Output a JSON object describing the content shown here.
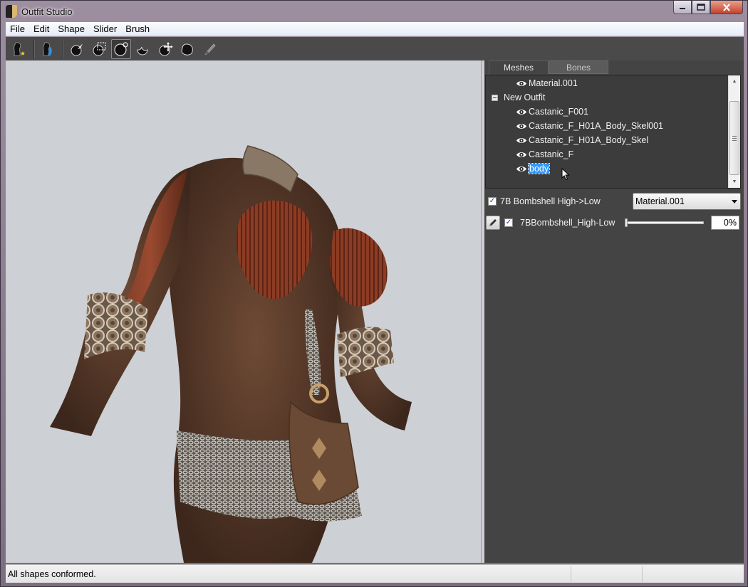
{
  "window": {
    "title": "Outfit Studio"
  },
  "menu": [
    "File",
    "Edit",
    "Shape",
    "Slider",
    "Brush"
  ],
  "toolbar": {
    "tools": [
      {
        "name": "load-reference-icon"
      },
      {
        "name": "load-outfit-icon"
      },
      {
        "name": "select-brush-icon"
      },
      {
        "name": "mask-brush-icon"
      },
      {
        "name": "inflate-brush-icon",
        "active": true
      },
      {
        "name": "deflate-brush-icon"
      },
      {
        "name": "move-brush-icon"
      },
      {
        "name": "smooth-brush-icon"
      },
      {
        "name": "weight-brush-icon"
      }
    ]
  },
  "tabs": [
    {
      "label": "Meshes",
      "active": true
    },
    {
      "label": "Bones",
      "active": false
    }
  ],
  "tree": {
    "group_label": "New Outfit",
    "items": [
      {
        "label": "Material.001",
        "level": 0,
        "type": "mesh"
      },
      {
        "label": "New Outfit",
        "level": 0,
        "type": "group"
      },
      {
        "label": "Castanic_F001",
        "level": 1,
        "type": "mesh"
      },
      {
        "label": "Castanic_F_H01A_Body_Skel001",
        "level": 1,
        "type": "mesh"
      },
      {
        "label": "Castanic_F_H01A_Body_Skel",
        "level": 1,
        "type": "mesh"
      },
      {
        "label": "Castanic_F",
        "level": 1,
        "type": "mesh"
      },
      {
        "label": "body",
        "level": 1,
        "type": "mesh",
        "selected": true
      }
    ]
  },
  "shape_row": {
    "label": "7B Bombshell High->Low",
    "checked": true,
    "dropdown_value": "Material.001"
  },
  "sliders": [
    {
      "label": "7BBombshell_High-Low",
      "checked": true,
      "value_text": "0%",
      "value": 0
    }
  ],
  "status": {
    "text": "All shapes conformed."
  },
  "colors": {
    "panel_bg": "#444444",
    "selection": "#3399ff",
    "viewport_bg": "#cdd0d4"
  }
}
